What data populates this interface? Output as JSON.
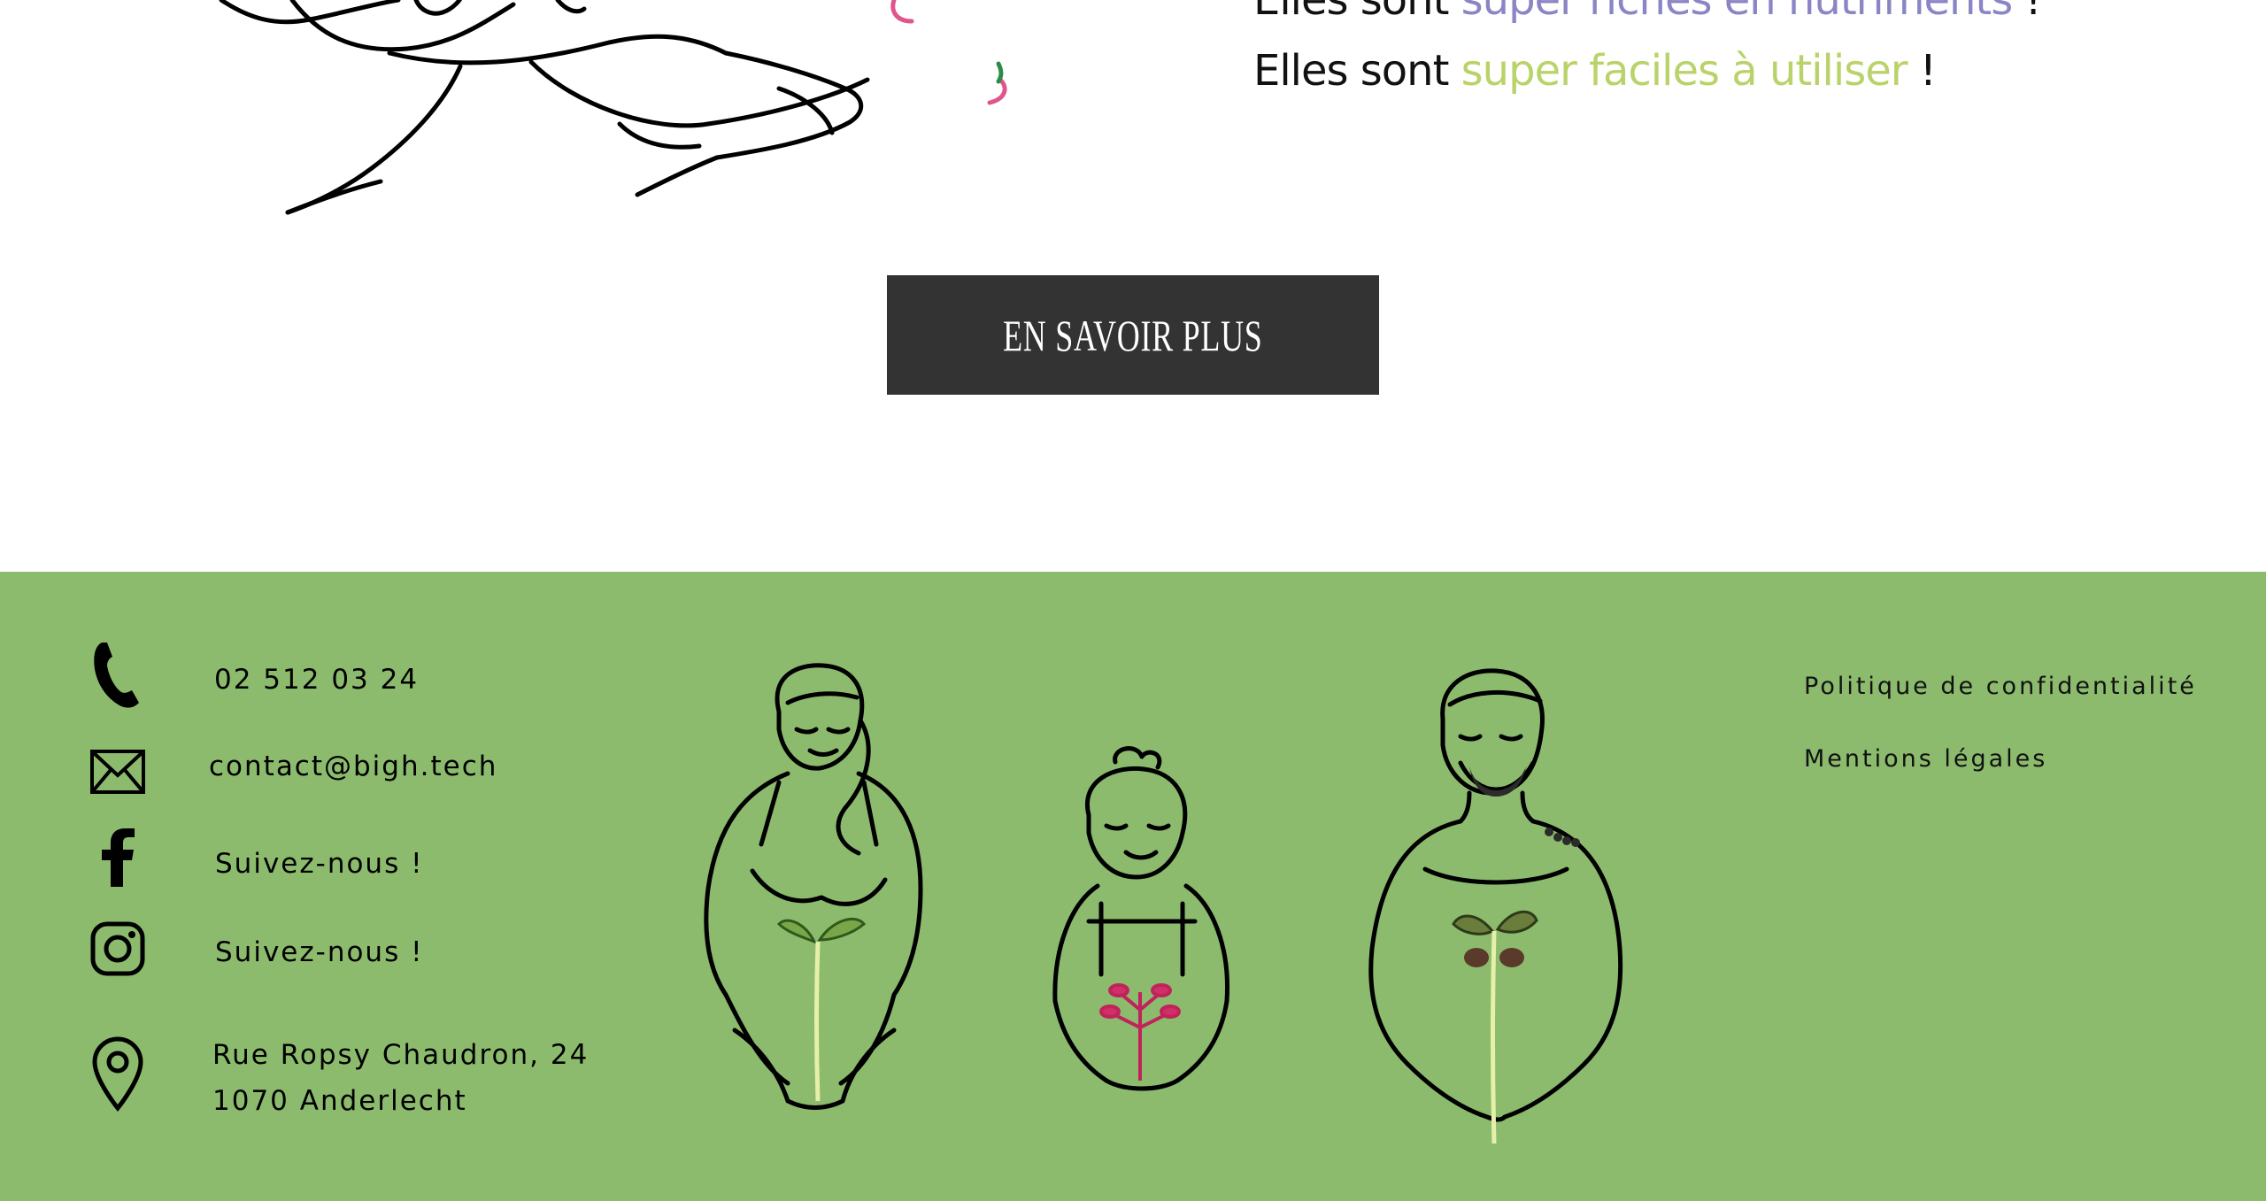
{
  "tagline": {
    "line1_prefix": "Elles sont ",
    "line1_highlight": "super riches en nutriments",
    "line1_suffix": " !",
    "line2_prefix": "Elles sont ",
    "line2_highlight": "super faciles à utiliser",
    "line2_suffix": " !"
  },
  "cta": {
    "label": "EN SAVOIR PLUS"
  },
  "footer": {
    "phone": "02 512 03 24",
    "email": "contact@bigh.tech",
    "facebook_label": "Suivez-nous !",
    "instagram_label": "Suivez-nous !",
    "address_line1": "Rue Ropsy Chaudron, 24",
    "address_line2": "1070 Anderlecht",
    "privacy_link": "Politique de confidentialité",
    "legal_link": "Mentions légales"
  },
  "colors": {
    "footer_bg": "#8cbb6e",
    "cta_bg": "#333333",
    "highlight_purple": "#8a86c6",
    "highlight_green": "#b9d36a"
  },
  "icons": [
    "phone-icon",
    "mail-icon",
    "facebook-icon",
    "instagram-icon",
    "location-pin-icon"
  ]
}
